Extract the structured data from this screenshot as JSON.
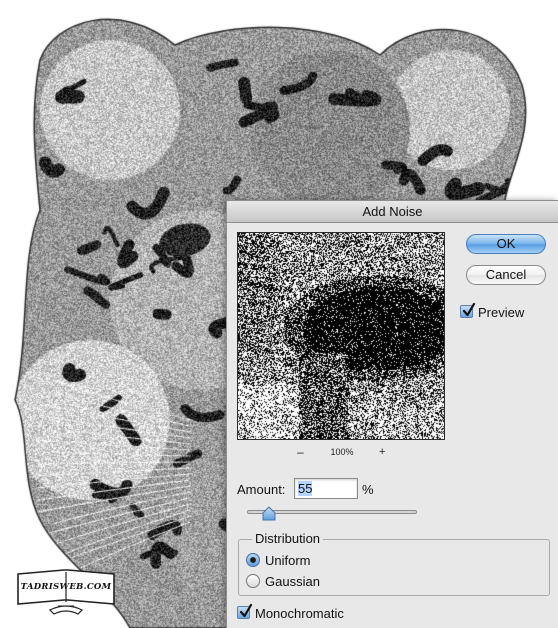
{
  "dialog": {
    "title": "Add Noise",
    "ok_label": "OK",
    "cancel_label": "Cancel",
    "preview_label": "Preview",
    "preview_checked": true,
    "zoom_out_label": "–",
    "zoom_level": "100%",
    "zoom_in_label": "+",
    "amount_label": "Amount:",
    "amount_value": "55",
    "amount_unit": "%",
    "amount_slider_fraction": 0.13,
    "distribution": {
      "legend": "Distribution",
      "options": [
        {
          "label": "Uniform",
          "selected": true
        },
        {
          "label": "Gaussian",
          "selected": false
        }
      ]
    },
    "monochromatic_label": "Monochromatic",
    "monochromatic_checked": true
  },
  "watermark": {
    "text": "TADRISWEB.COM"
  },
  "colors": {
    "ok_button": "#6aa9e9",
    "checkbox": "#6aa5e2",
    "dialog_bg": "#e8e8e8"
  }
}
